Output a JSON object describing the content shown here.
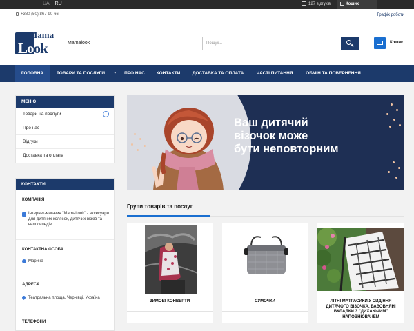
{
  "colors": {
    "brand": "#1c3a6b",
    "accent": "#1a6fd0",
    "topbar": "#2b2b2b"
  },
  "topbar": {
    "lang_ua": "UA",
    "lang_ru": "RU",
    "reviews": "127 відгуків",
    "cart_label": "Кошик"
  },
  "phonebar": {
    "phone": "+380 (50) 867-90-66",
    "schedule": "Графік роботи"
  },
  "header": {
    "logo_top": "Mama",
    "logo_bottom_1": "Lo",
    "logo_bottom_2": "ok",
    "shop_name": "Mamalook",
    "search_placeholder": "Пошук...",
    "cart_label": "Кошик"
  },
  "nav": {
    "items": [
      "ГОЛОВНА",
      "ТОВАРИ ТА ПОСЛУГИ",
      "ПРО НАС",
      "КОНТАКТИ",
      "ДОСТАВКА ТА ОПЛАТА",
      "ЧАСТІ ПИТАННЯ",
      "ОБМІН ТА ПОВЕРНЕННЯ"
    ],
    "active_index": 0
  },
  "sidebar": {
    "menu_title": "МЕНЮ",
    "menu_items": [
      "Товари на послуги",
      "Про нас",
      "Відгуки",
      "Доставка та оплата"
    ],
    "contacts_title": "КОНТАКТИ",
    "contacts": [
      {
        "title": "КОМПАНІЯ",
        "value": "Інтернет-магазин \"MamaLook\" - аксесуари для дитячих колясок, дитячих візків та велосипедів"
      },
      {
        "title": "КОНТАКТНА ОСОБА",
        "value": "Марина"
      },
      {
        "title": "АДРЕСА",
        "value": "Театральна площа, Чернівці, Україна"
      },
      {
        "title": "ТЕЛЕФОНИ",
        "value": ""
      }
    ]
  },
  "banner": {
    "line1": "Ваш дитячий",
    "line2": "візочок може",
    "line3": "бути неповторним"
  },
  "groups": {
    "title": "Групи товарів та послуг",
    "items": [
      "ЗИМОВІ КОНВЕРТИ",
      "СУМОЧКИ",
      "ЛІТНІ МАТРАСИКИ У СИДІННЯ ДИТЯЧОГО ВІЗОЧКА, БАВОВНЯНІ ВКЛАДКИ З \"ДИХАЮЧИМ\" НАПОВНЮВАЧЕМ"
    ]
  }
}
